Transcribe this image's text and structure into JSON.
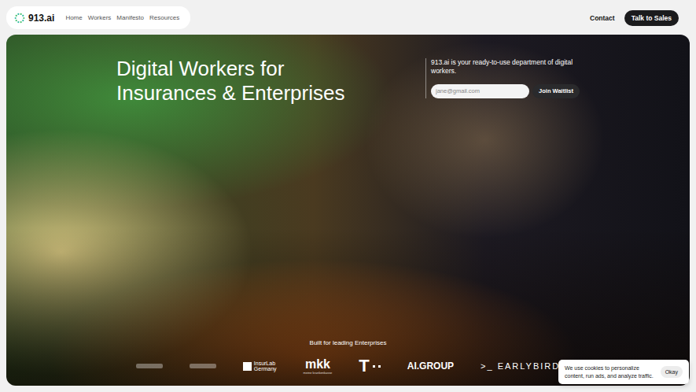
{
  "nav": {
    "logo": "913.ai",
    "links": [
      {
        "label": "Home"
      },
      {
        "label": "Workers"
      },
      {
        "label": "Manifesto"
      },
      {
        "label": "Resources"
      }
    ],
    "contact": "Contact",
    "cta": "Talk to Sales"
  },
  "hero": {
    "title_lines": [
      "Digital Workers for",
      "Insurances & Enterprises"
    ],
    "description": "913.ai is your ready-to-use department of digital workers.",
    "email_placeholder": "jane@gmail.com",
    "join_button": "Join Waitlist"
  },
  "partners": {
    "title": "Built for leading Enterprises",
    "logos": [
      {
        "kind": "mark"
      },
      {
        "kind": "mark"
      },
      {
        "kind": "boxed",
        "label": "InsurLab",
        "sub": "Germany"
      },
      {
        "kind": "stacked",
        "label": "mkk",
        "sub": "meine krankenkasse"
      },
      {
        "kind": "telekom",
        "label": "T"
      },
      {
        "kind": "bold",
        "label": "AI.GROUP"
      },
      {
        "kind": "prompt",
        "prefix": ">_",
        "label": "EARLYBIRD"
      }
    ]
  },
  "cookie": {
    "text": "We use cookies to personalize content, run ads, and analyze traffic.",
    "button": "Okay"
  }
}
